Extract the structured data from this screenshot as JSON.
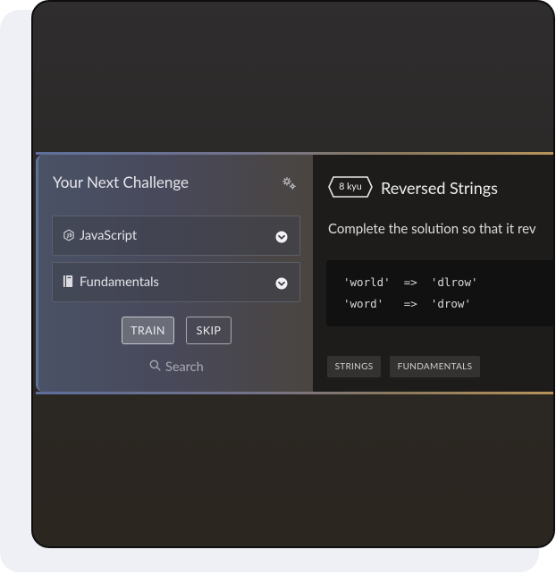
{
  "challenge_panel": {
    "title": "Your Next Challenge",
    "settings_icon": "cogs-icon",
    "language_select": {
      "icon": "js-icon",
      "value": "JavaScript"
    },
    "focus_select": {
      "icon": "book-icon",
      "value": "Fundamentals"
    },
    "train_label": "TRAIN",
    "skip_label": "SKIP",
    "search_label": "Search"
  },
  "kata": {
    "rank": "8 kyu",
    "title": "Reversed Strings",
    "description": "Complete the solution so that it rev",
    "code_lines": [
      "'world'  =>  'dlrow'",
      "'word'   =>  'drow'"
    ],
    "tags": [
      "STRINGS",
      "FUNDAMENTALS"
    ]
  },
  "colors": {
    "accent_left": "#62719a",
    "accent_right": "#b7945b",
    "panel_dark": "#1d1c1b"
  }
}
